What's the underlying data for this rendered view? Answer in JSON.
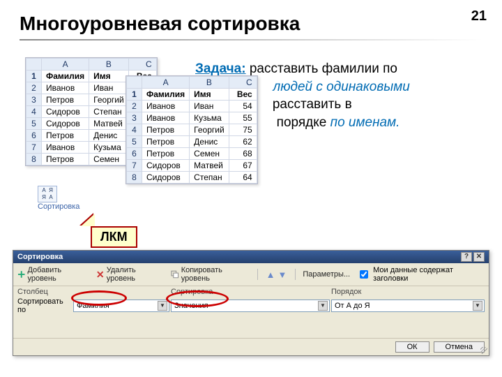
{
  "page_number": "21",
  "title": "Многоуровневая сортировка",
  "task": {
    "label": "Задача:",
    "part1": "  расставить фамилии по",
    "part2_italic": "людей с одинаковыми",
    "part3": " расставить в",
    "part4": " порядке ",
    "part4_italic": "по именам."
  },
  "sheet_headers": {
    "a": "A",
    "b": "B",
    "c": "C"
  },
  "data_headers": {
    "fam": "Фамилия",
    "name": "Имя",
    "weight": "Вес"
  },
  "sheet1_rows": [
    [
      "1",
      "Фамилия",
      "Имя",
      "Вес"
    ],
    [
      "2",
      "Иванов",
      "Иван",
      ""
    ],
    [
      "3",
      "Петров",
      "Георгий",
      ""
    ],
    [
      "4",
      "Сидоров",
      "Степан",
      ""
    ],
    [
      "5",
      "Сидоров",
      "Матвей",
      ""
    ],
    [
      "6",
      "Петров",
      "Денис",
      ""
    ],
    [
      "7",
      "Иванов",
      "Кузьма",
      ""
    ],
    [
      "8",
      "Петров",
      "Семен",
      ""
    ]
  ],
  "sheet2_rows": [
    [
      "1",
      "Фамилия",
      "Имя",
      "Вес"
    ],
    [
      "2",
      "Иванов",
      "Иван",
      "54"
    ],
    [
      "3",
      "Иванов",
      "Кузьма",
      "55"
    ],
    [
      "4",
      "Петров",
      "Георгий",
      "75"
    ],
    [
      "5",
      "Петров",
      "Денис",
      "62"
    ],
    [
      "6",
      "Петров",
      "Семен",
      "68"
    ],
    [
      "7",
      "Сидоров",
      "Матвей",
      "67"
    ],
    [
      "8",
      "Сидоров",
      "Степан",
      "64"
    ]
  ],
  "sort_label": "Сортировка",
  "callout": "ЛКМ",
  "dialog": {
    "title": "Сортировка",
    "add_level": "Добавить уровень",
    "del_level": "Удалить уровень",
    "copy_level": "Копировать уровень",
    "params": "Параметры...",
    "headers_chk": "Мои данные содержат заголовки",
    "col_hdr": "Столбец",
    "sort_hdr": "Сортировка",
    "order_hdr": "Порядок",
    "row_label": "Сортировать по",
    "col_value": "Фамилия",
    "sort_value": "Значения",
    "order_value": "От А до Я",
    "ok": "ОК",
    "cancel": "Отмена"
  }
}
